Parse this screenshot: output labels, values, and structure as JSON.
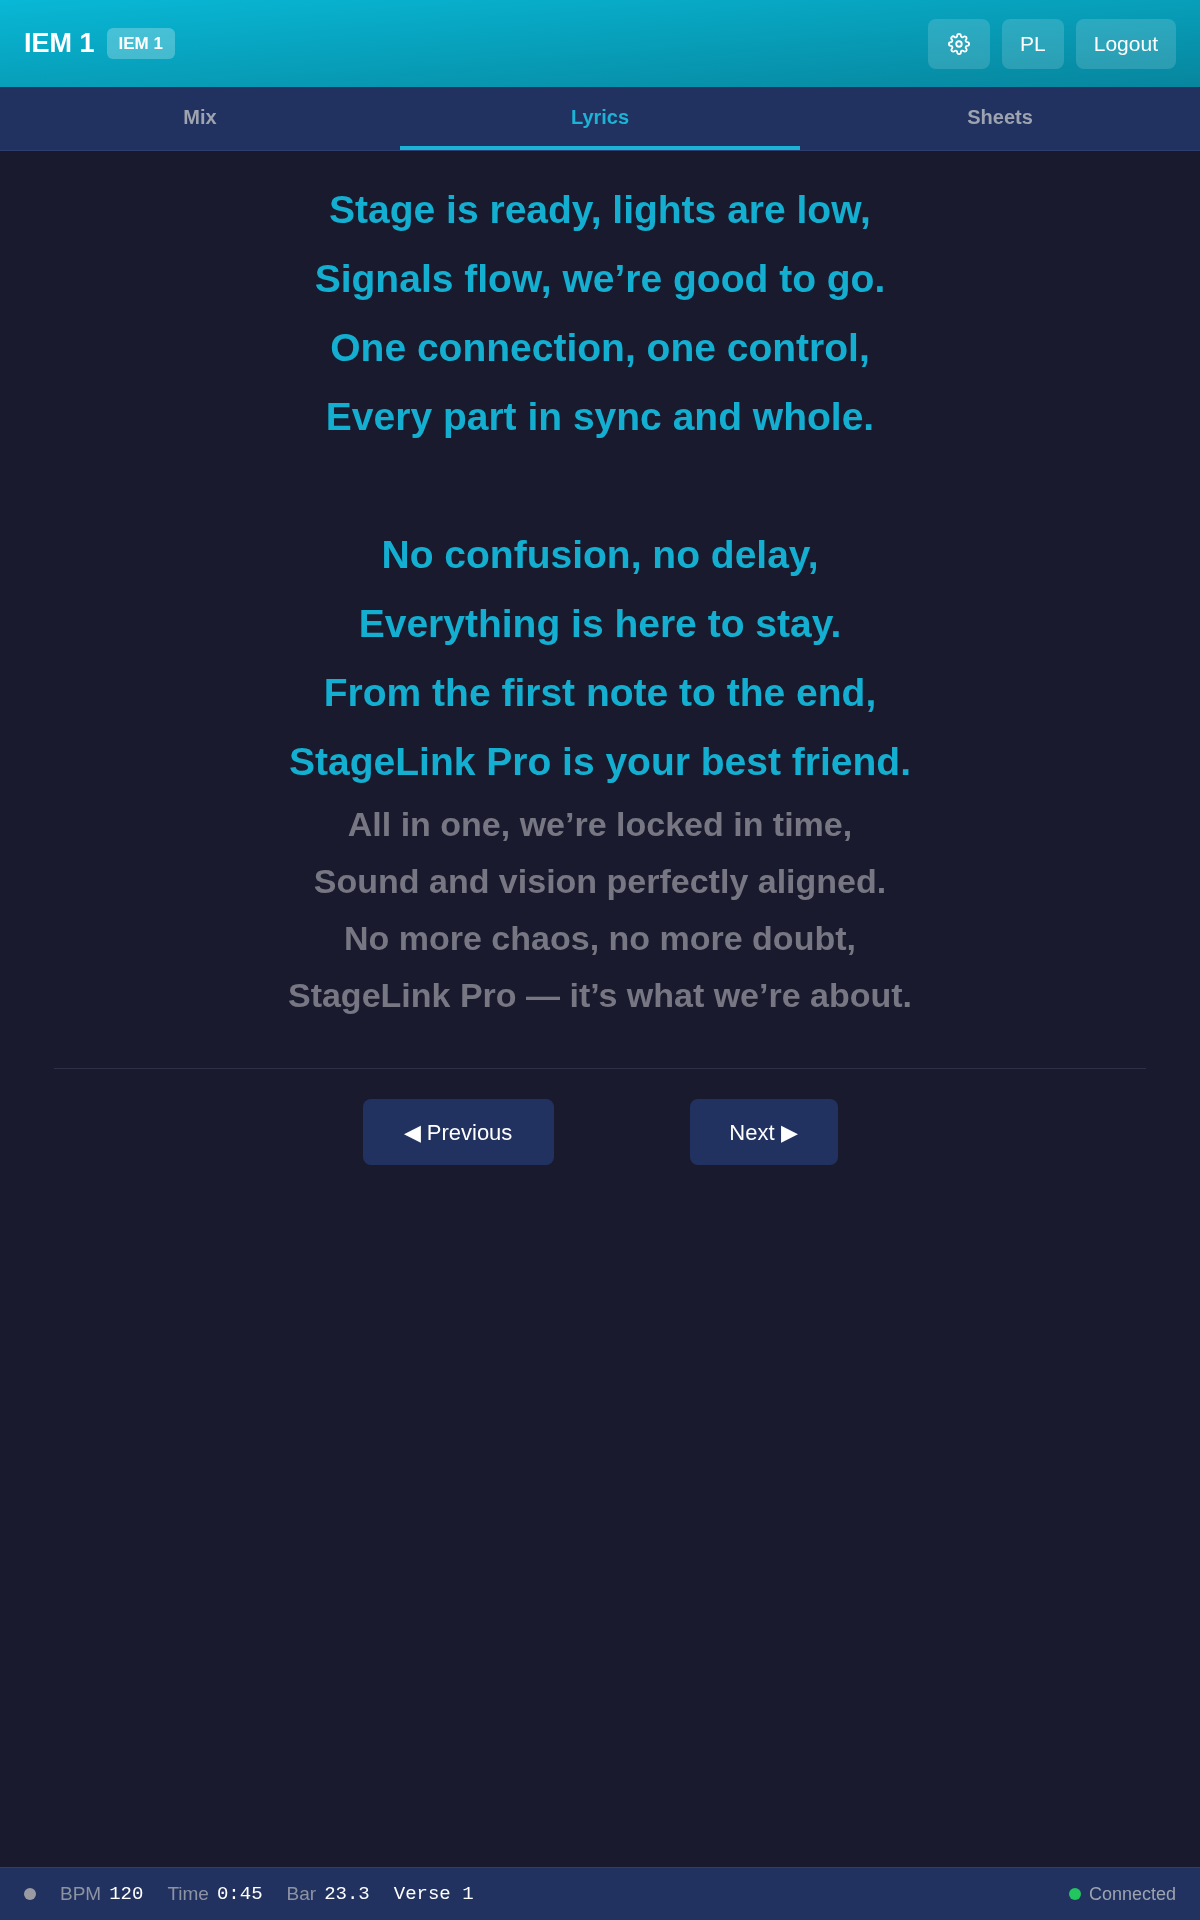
{
  "header": {
    "title": "IEM 1",
    "badge": "IEM 1",
    "buttons": [
      {
        "kind": "settings"
      },
      {
        "kind": "text",
        "label": "PL"
      },
      {
        "kind": "text",
        "label": "Logout"
      }
    ]
  },
  "tabs": [
    {
      "label": "Mix",
      "selected": false
    },
    {
      "label": "Lyrics",
      "selected": true
    },
    {
      "label": "Sheets",
      "selected": false
    }
  ],
  "lyrics": [
    {
      "active": true,
      "lines": [
        "Stage is ready, lights are low,",
        "Signals flow, we’re good to go.",
        "One connection, one control,",
        "Every part in sync and whole."
      ]
    },
    {
      "active": true,
      "lines": [
        "No confusion, no delay,",
        "Everything is here to stay.",
        "From the first note to the end,",
        "StageLink Pro is your best friend."
      ]
    },
    {
      "active": false,
      "lines": [
        "All in one, we’re locked in time,",
        "Sound and vision perfectly aligned.",
        "No more chaos, no more doubt,",
        "StageLink Pro — it’s what we’re about."
      ]
    }
  ],
  "navigation": {
    "previous": "◀ Previous",
    "next": "Next ▶"
  },
  "status_bar": {
    "indicator_on": false,
    "items": [
      {
        "label": "BPM",
        "value": "120"
      },
      {
        "label": "Time",
        "value": "0:45"
      },
      {
        "label": "Bar",
        "value": "23.3"
      },
      {
        "value": "Verse 1"
      }
    ],
    "connection": {
      "label": "Connected",
      "color": "#22c55e"
    }
  }
}
